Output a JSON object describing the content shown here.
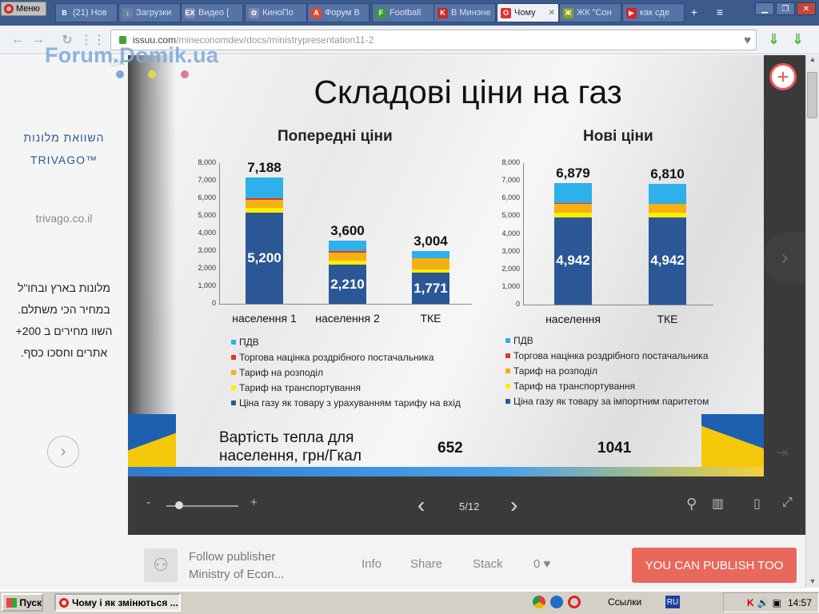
{
  "browser": {
    "menu_label": "Меню",
    "tabs": [
      {
        "label": "(21) Нов",
        "icon": "vk-icon",
        "color": "#4c75a3",
        "glyph": "B"
      },
      {
        "label": "Загрузки",
        "icon": "download-icon",
        "color": "#6b7f9e",
        "glyph": "↓"
      },
      {
        "label": "Видео [",
        "icon": "ex-icon",
        "color": "#7a8ba8",
        "glyph": "EX"
      },
      {
        "label": "КиноПо",
        "icon": "film-icon",
        "color": "#7a8ba8",
        "glyph": "✿"
      },
      {
        "label": "Форум В",
        "icon": "forum-icon",
        "color": "#e04a2a",
        "glyph": "A"
      },
      {
        "label": "Football",
        "icon": "football-icon",
        "color": "#3a9a3a",
        "glyph": "F"
      },
      {
        "label": "В Минэне",
        "icon": "k-icon",
        "color": "#c42a2a",
        "glyph": "K"
      },
      {
        "label": "Чому",
        "icon": "opera-icon",
        "color": "#d33",
        "glyph": "O",
        "active": true
      },
      {
        "label": "ЖК \"Сон",
        "icon": "housing-icon",
        "color": "#8aa020",
        "glyph": "Ж"
      },
      {
        "label": "как сде",
        "icon": "youtube-icon",
        "color": "#d22",
        "glyph": "▶"
      }
    ],
    "url_domain": "issuu.com",
    "url_path": "/mineconomdev/docs/ministrypresentation11-2"
  },
  "watermark": "Forum.Domik.ua",
  "ad": {
    "title_line1": "השוואת מלונות",
    "title_line2": "TRIVAGO™",
    "domain": "trivago.co.il",
    "body": "מלונות בארץ ובחו\"ל במחיר הכי משתלם. השוו מחירים ב 200+ אתרים וחסכו כסף."
  },
  "slide": {
    "title": "Складові ціни на газ",
    "heat_label_line1": "Вартість тепла для",
    "heat_label_line2": "населення, грн/Гкал",
    "heat_value_old": "652",
    "heat_value_new": "1041"
  },
  "chart_data": [
    {
      "type": "bar",
      "stacked": true,
      "title": "Попередні ціни",
      "categories": [
        "населення 1",
        "населення 2",
        "ТКЕ"
      ],
      "ylim": [
        0,
        8000
      ],
      "ticks": [
        "0",
        "1,000",
        "2,000",
        "3,000",
        "4,000",
        "5,000",
        "6,000",
        "7,000",
        "8,000"
      ],
      "totals": [
        "7,188",
        "3,600",
        "3,004"
      ],
      "base_labels": [
        "5,200",
        "2,210",
        "1,771"
      ],
      "series": [
        {
          "name": "Ціна газу як товару з урахуванням тарифу на вхід",
          "color": "#2b5796",
          "values": [
            5200,
            2210,
            1771
          ]
        },
        {
          "name": "Тариф на транспортування",
          "color": "#ffee00",
          "values": [
            250,
            230,
            200
          ]
        },
        {
          "name": "Тариф на розподіл",
          "color": "#f5b014",
          "values": [
            450,
            480,
            600
          ]
        },
        {
          "name": "Торгова націнка роздрібного постачальника",
          "color": "#e03a20",
          "values": [
            100,
            80,
            0
          ]
        },
        {
          "name": "ПДВ",
          "color": "#2eb0ea",
          "values": [
            1188,
            600,
            433
          ]
        }
      ]
    },
    {
      "type": "bar",
      "stacked": true,
      "title": "Нові ціни",
      "categories": [
        "населення",
        "ТКЕ"
      ],
      "ylim": [
        0,
        8000
      ],
      "ticks": [
        "0",
        "1,000",
        "2,000",
        "3,000",
        "4,000",
        "5,000",
        "6,000",
        "7,000",
        "8,000"
      ],
      "totals": [
        "6,879",
        "6,810"
      ],
      "base_labels": [
        "4,942",
        "4,942"
      ],
      "series": [
        {
          "name": "Ціна газу як товару за імпортним паритетом",
          "color": "#2b5796",
          "values": [
            4942,
            4942
          ]
        },
        {
          "name": "Тариф на транспортування",
          "color": "#ffee00",
          "values": [
            240,
            240
          ]
        },
        {
          "name": "Тариф на розподіл",
          "color": "#f5b014",
          "values": [
            500,
            500
          ]
        },
        {
          "name": "Торгова націнка роздрібного постачальника",
          "color": "#e03a20",
          "values": [
            50,
            0
          ]
        },
        {
          "name": "ПДВ",
          "color": "#2eb0ea",
          "values": [
            1147,
            1128
          ]
        }
      ]
    }
  ],
  "viewer": {
    "page_indicator": "5/12",
    "zoom_minus": "-",
    "zoom_plus": "+"
  },
  "footer": {
    "follow_line1": "Follow publisher",
    "follow_line2": "Ministry of Econ...",
    "info": "Info",
    "share": "Share",
    "stack": "Stack",
    "likes": "0",
    "publish": "YOU CAN PUBLISH TOO"
  },
  "taskbar": {
    "start": "Пуск",
    "task": "Чому і як змінються ...",
    "links": "Ссылки",
    "lang": "RU",
    "clock": "14:57"
  }
}
